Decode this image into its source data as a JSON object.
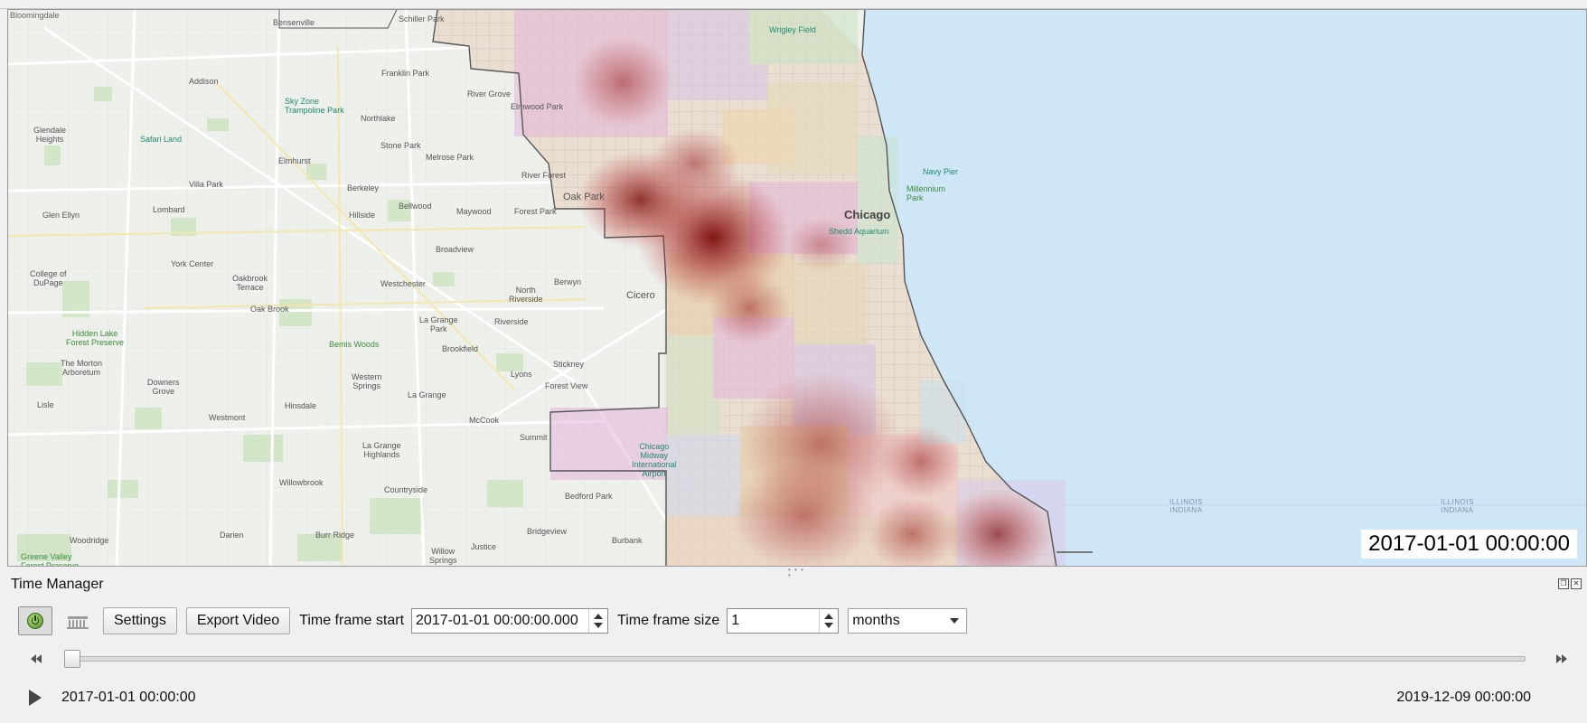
{
  "map": {
    "corner_label": "Bloomingdale",
    "time_overlay": "2017-01-01 00:00:00",
    "city_label": "Chicago",
    "places": [
      {
        "id": "bensenville",
        "name": "Bensenville"
      },
      {
        "id": "schiller-park",
        "name": "Schiller Park"
      },
      {
        "id": "addison",
        "name": "Addison"
      },
      {
        "id": "franklin-park",
        "name": "Franklin Park"
      },
      {
        "id": "river-grove",
        "name": "River Grove"
      },
      {
        "id": "elmwood-park",
        "name": "Elmwood Park"
      },
      {
        "id": "northlake",
        "name": "Northlake"
      },
      {
        "id": "glendale-heights",
        "name": "Glendale\nHeights"
      },
      {
        "id": "elmhurst",
        "name": "Elmhurst"
      },
      {
        "id": "stone-park",
        "name": "Stone Park"
      },
      {
        "id": "melrose-park",
        "name": "Melrose Park"
      },
      {
        "id": "river-forest",
        "name": "River Forest"
      },
      {
        "id": "villa-park",
        "name": "Villa Park"
      },
      {
        "id": "berkeley",
        "name": "Berkeley"
      },
      {
        "id": "oak-park",
        "name": "Oak Park"
      },
      {
        "id": "bellwood",
        "name": "Bellwood"
      },
      {
        "id": "glen-ellyn",
        "name": "Glen Ellyn"
      },
      {
        "id": "lombard",
        "name": "Lombard"
      },
      {
        "id": "hillside",
        "name": "Hillside"
      },
      {
        "id": "maywood",
        "name": "Maywood"
      },
      {
        "id": "forest-park",
        "name": "Forest Park"
      },
      {
        "id": "broadview",
        "name": "Broadview"
      },
      {
        "id": "york-center",
        "name": "York Center"
      },
      {
        "id": "college-of-dupage",
        "name": "College of\nDuPage"
      },
      {
        "id": "oakbrook-terrace",
        "name": "Oakbrook\nTerrace"
      },
      {
        "id": "westchester",
        "name": "Westchester"
      },
      {
        "id": "berwyn",
        "name": "Berwyn"
      },
      {
        "id": "north-riverside",
        "name": "North\nRiverside"
      },
      {
        "id": "cicero",
        "name": "Cicero"
      },
      {
        "id": "oak-brook",
        "name": "Oak Brook"
      },
      {
        "id": "la-grange-park",
        "name": "La Grange\nPark"
      },
      {
        "id": "riverside",
        "name": "Riverside"
      },
      {
        "id": "brookfield",
        "name": "Brookfield"
      },
      {
        "id": "stickney",
        "name": "Stickney"
      },
      {
        "id": "the-morton-arboretum",
        "name": "The Morton\nArboretum"
      },
      {
        "id": "downers-grove",
        "name": "Downers\nGrove"
      },
      {
        "id": "western-springs",
        "name": "Western\nSprings"
      },
      {
        "id": "la-grange",
        "name": "La Grange"
      },
      {
        "id": "lyons",
        "name": "Lyons"
      },
      {
        "id": "forest-view",
        "name": "Forest View"
      },
      {
        "id": "lisle",
        "name": "Lisle"
      },
      {
        "id": "westmont",
        "name": "Westmont"
      },
      {
        "id": "hinsdale",
        "name": "Hinsdale"
      },
      {
        "id": "mccook",
        "name": "McCook"
      },
      {
        "id": "summit",
        "name": "Summit"
      },
      {
        "id": "la-grange-highlands",
        "name": "La Grange\nHighlands"
      },
      {
        "id": "willowbrook",
        "name": "Willowbrook"
      },
      {
        "id": "countryside",
        "name": "Countryside"
      },
      {
        "id": "bedford-park",
        "name": "Bedford Park"
      },
      {
        "id": "woodridge",
        "name": "Woodridge"
      },
      {
        "id": "darien",
        "name": "Darien"
      },
      {
        "id": "burr-ridge",
        "name": "Burr Ridge"
      },
      {
        "id": "bridgeview",
        "name": "Bridgeview"
      },
      {
        "id": "burbank",
        "name": "Burbank"
      },
      {
        "id": "justice",
        "name": "Justice"
      },
      {
        "id": "willow-springs",
        "name": "Willow\nSprings"
      },
      {
        "id": "greene-valley",
        "name": "Greene Valley\nForest Preserve"
      },
      {
        "id": "bensenville-2",
        "name": ""
      }
    ],
    "pois": [
      {
        "id": "sky-zone",
        "name": "Sky Zone\nTrampoline Park"
      },
      {
        "id": "safari-land",
        "name": "Safari Land"
      },
      {
        "id": "hidden-lake",
        "name": "Hidden Lake\nForest Preserve"
      },
      {
        "id": "wrigley-field",
        "name": "Wrigley Field"
      },
      {
        "id": "navy-pier",
        "name": "Navy Pier"
      },
      {
        "id": "millennium-park",
        "name": "Millennium\nPark"
      },
      {
        "id": "shedd-aquarium",
        "name": "Shedd Aquarium"
      },
      {
        "id": "chicago-midway",
        "name": "Chicago\nMidway\nInternational\nAirport"
      },
      {
        "id": "busse-woods",
        "name": "Bemis Woods"
      }
    ],
    "water_labels": [
      {
        "id": "illinois-indiana-1",
        "name": "ILLINOIS\nINDIANA"
      },
      {
        "id": "illinois-indiana-2",
        "name": "ILLINOIS\nINDIANA"
      }
    ]
  },
  "panel": {
    "title": "Time Manager",
    "settings_label": "Settings",
    "export_video_label": "Export Video",
    "time_frame_start_label": "Time frame start",
    "time_frame_start_value": "2017-01-01 00:00:00.000",
    "time_frame_size_label": "Time frame size",
    "time_frame_size_value": "1",
    "time_frame_unit": "months",
    "slider_position": 0.0,
    "start_time": "2017-01-01 00:00:00",
    "end_time": "2019-12-09 00:00:00"
  }
}
